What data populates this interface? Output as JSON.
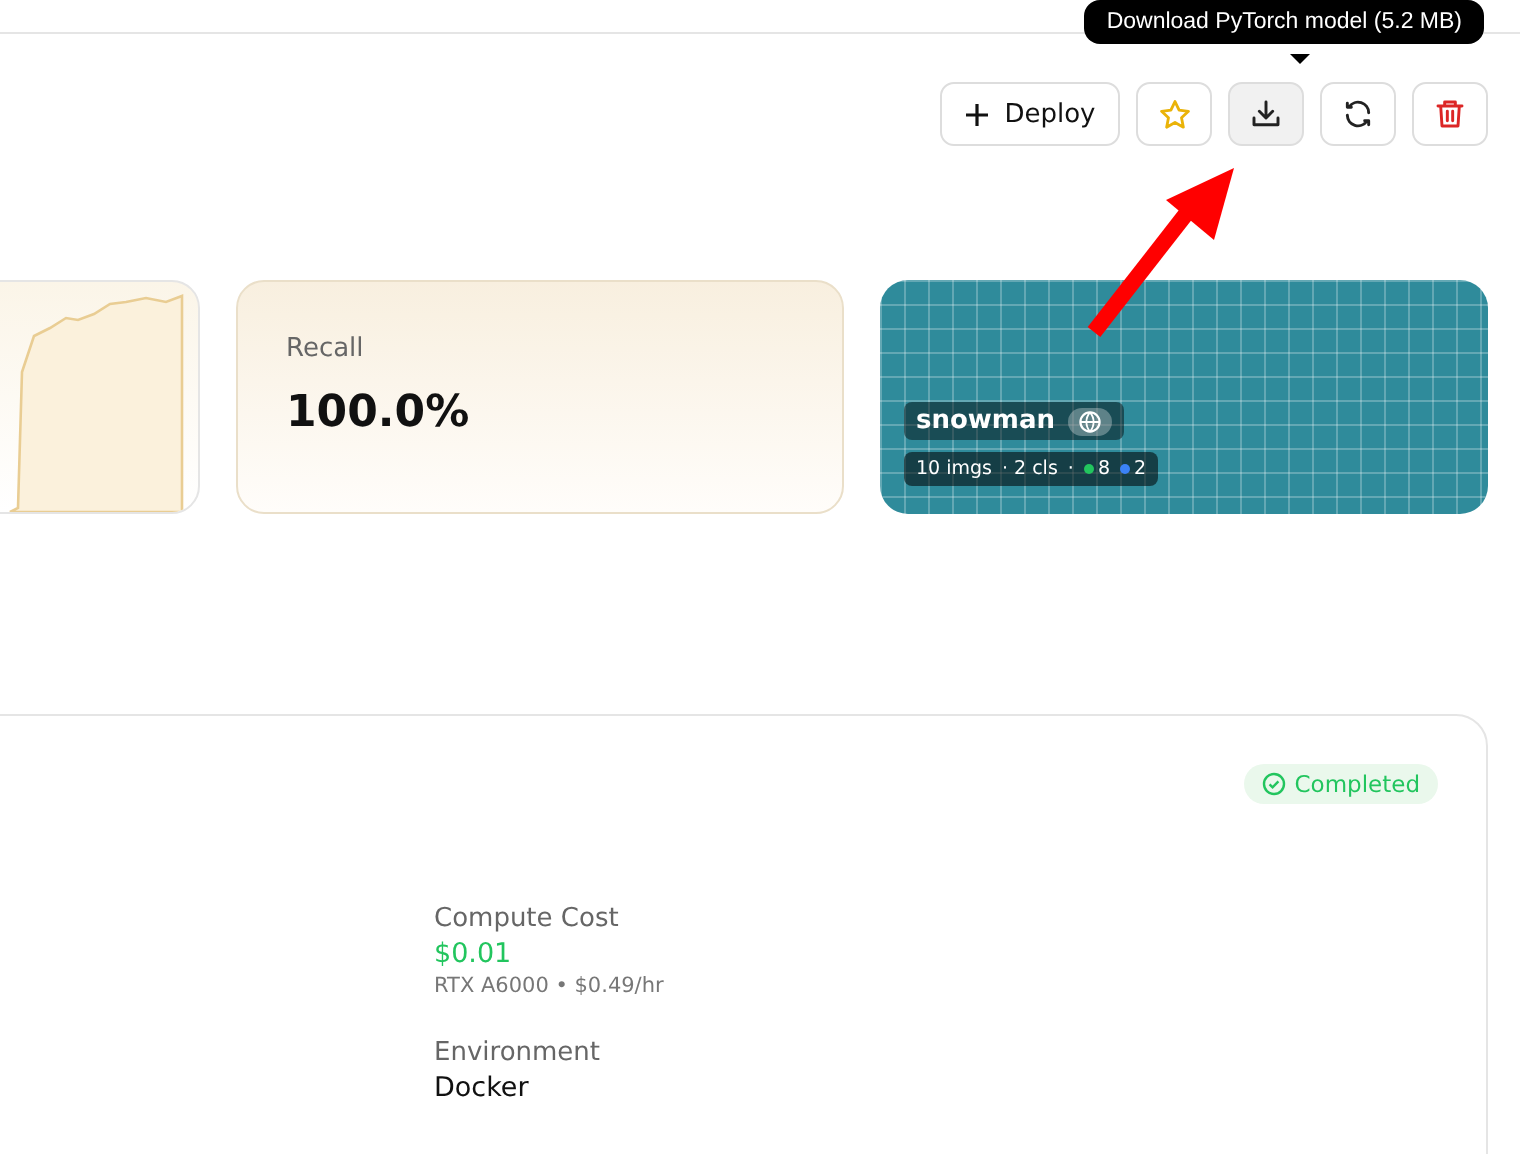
{
  "toolbar": {
    "buttons": [
      {
        "kind": "deploy",
        "label": "Deploy",
        "hovered": false
      },
      {
        "kind": "star",
        "hovered": false
      },
      {
        "kind": "download",
        "hovered": true
      },
      {
        "kind": "refresh",
        "hovered": false
      },
      {
        "kind": "delete",
        "hovered": false
      }
    ],
    "tooltip": "Download PyTorch model (5.2 MB)"
  },
  "metrics": {
    "recall": {
      "label": "Recall",
      "value": "100.0%"
    }
  },
  "dataset": {
    "name": "snowman",
    "images": "10 imgs",
    "classes": "· 2 cls",
    "separator": "·",
    "counts": [
      {
        "count": "8",
        "color": "#22c55e"
      },
      {
        "count": "2",
        "color": "#3b82f6"
      }
    ]
  },
  "details": {
    "status": "Completed",
    "fields": [
      {
        "kind": "cost",
        "label": "Compute Cost",
        "value": "$0.01",
        "note": "RTX A6000 • $0.49/hr"
      },
      {
        "kind": "plain",
        "label": "Environment",
        "value": "Docker"
      }
    ]
  }
}
